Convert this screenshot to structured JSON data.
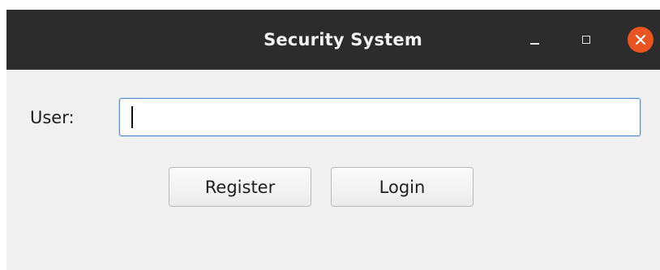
{
  "window": {
    "title": "Security System",
    "controls": {
      "minimize_icon": "minimize-icon",
      "maximize_icon": "maximize-icon",
      "close_icon": "close-icon",
      "close_color": "#e95420"
    },
    "titlebar_color": "#2c2c2c",
    "body_color": "#f0f0f0"
  },
  "form": {
    "user_label": "User:",
    "user_value": "",
    "register_label": "Register",
    "login_label": "Login"
  }
}
